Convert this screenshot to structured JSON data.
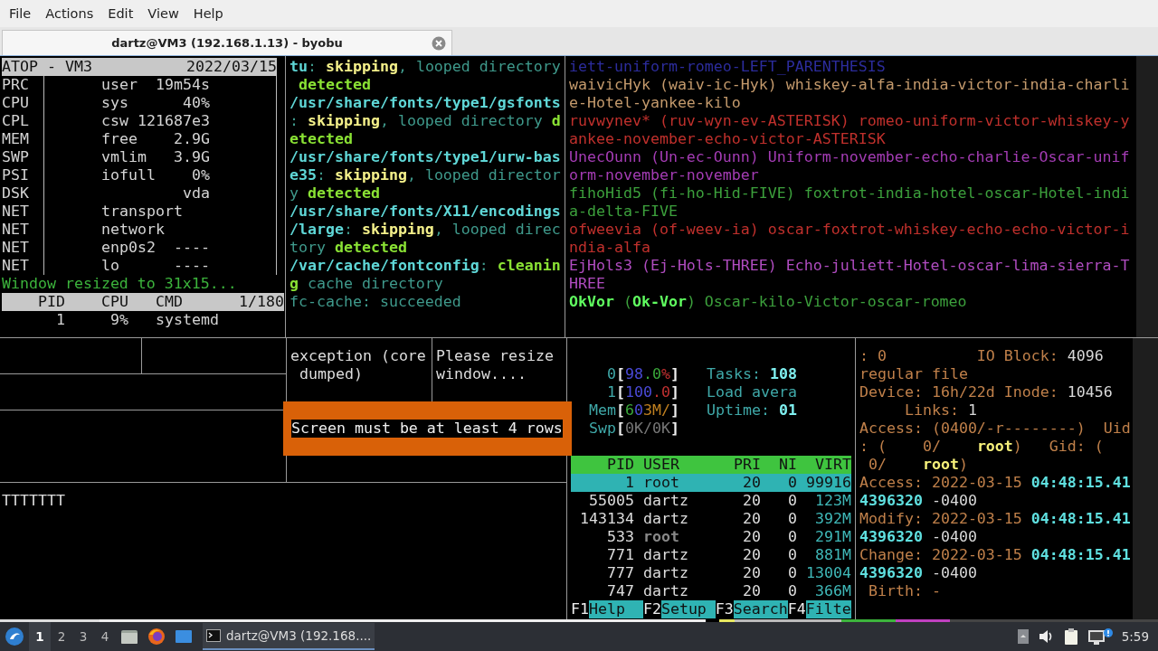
{
  "menu": [
    "File",
    "Actions",
    "Edit",
    "View",
    "Help"
  ],
  "tabs": [
    {
      "title": "dartz@VM3 (192.168.1.13) - byobu",
      "selected": true
    }
  ],
  "atop": {
    "title": "ATOP - VM3",
    "date": "2022/03/15",
    "rows": [
      {
        "label": "PRC",
        "key": "user",
        "value": "19m54s"
      },
      {
        "label": "CPU",
        "key": "sys",
        "value": "40%"
      },
      {
        "label": "CPL",
        "key": "csw",
        "value": "121687e3"
      },
      {
        "label": "MEM",
        "key": "free",
        "value": "2.9G"
      },
      {
        "label": "SWP",
        "key": "vmlim",
        "value": "3.9G"
      },
      {
        "label": "PSI",
        "key": "iofull",
        "value": "0%"
      },
      {
        "label": "DSK",
        "value": "vda"
      },
      {
        "label": "NET",
        "key": "transport"
      },
      {
        "label": "NET",
        "key": "network"
      },
      {
        "label": "NET",
        "key": "enp0s2",
        "value": "----"
      },
      {
        "label": "NET",
        "key": "lo",
        "value": "----"
      }
    ],
    "message": "Window resized to 31x15...",
    "proc_columns": [
      "PID",
      "CPU",
      "CMD"
    ],
    "proc_count": "1/180",
    "procs": [
      {
        "pid": "1",
        "cpu": "9%",
        "cmd": "systemd"
      }
    ]
  },
  "fc_cache_log": [
    [
      {
        "text": "tu",
        "kind": "path"
      },
      {
        "text": ": ",
        "kind": "dim"
      },
      {
        "text": "skipping",
        "kind": "warn"
      },
      {
        "text": ", looped directory",
        "kind": "dim"
      }
    ],
    [
      {
        "text": " detected",
        "kind": "ok"
      }
    ],
    [
      {
        "text": "/usr/share/fonts/type1/gsfonts",
        "kind": "path"
      }
    ],
    [
      {
        "text": ": ",
        "kind": "dim"
      },
      {
        "text": "skipping",
        "kind": "warn"
      },
      {
        "text": ", looped directory ",
        "kind": "dim"
      },
      {
        "text": "d",
        "kind": "ok"
      }
    ],
    [
      {
        "text": "etected",
        "kind": "ok"
      }
    ],
    [
      {
        "text": "/usr/share/fonts/type1/urw-bas",
        "kind": "path"
      }
    ],
    [
      {
        "text": "e35",
        "kind": "path"
      },
      {
        "text": ": ",
        "kind": "dim"
      },
      {
        "text": "skipping",
        "kind": "warn"
      },
      {
        "text": ", looped director",
        "kind": "dim"
      }
    ],
    [
      {
        "text": "y ",
        "kind": "dim"
      },
      {
        "text": "detected",
        "kind": "ok"
      }
    ],
    [
      {
        "text": "/usr/share/fonts/X11/encodings",
        "kind": "path"
      }
    ],
    [
      {
        "text": "/large",
        "kind": "path"
      },
      {
        "text": ": ",
        "kind": "dim"
      },
      {
        "text": "skipping",
        "kind": "warn"
      },
      {
        "text": ", looped direc",
        "kind": "dim"
      }
    ],
    [
      {
        "text": "tory ",
        "kind": "dim"
      },
      {
        "text": "detected",
        "kind": "ok"
      }
    ],
    [
      {
        "text": "/var/cache/fontconfig",
        "kind": "path"
      },
      {
        "text": ": ",
        "kind": "dim"
      },
      {
        "text": "cleanin",
        "kind": "ok"
      }
    ],
    [
      {
        "text": "g",
        "kind": "ok"
      },
      {
        "text": " cache directory",
        "kind": "dim"
      }
    ],
    [
      {
        "text": "fc-cache: succeeded",
        "kind": "dim"
      }
    ]
  ],
  "word_list": [
    {
      "text": "iett-uniform-romeo-LEFT_PARENTHESIS",
      "color": "#2c2c9c"
    },
    {
      "text": "waivicHyk (waiv-ic-Hyk) whiskey-alfa-india-victor-india-charlie-Hotel-yankee-kilo",
      "color": "#c49a6c"
    },
    {
      "text": "ruvwynev* (ruv-wyn-ev-ASTERISK) romeo-uniform-victor-whiskey-yankee-november-echo-victor-ASTERISK",
      "color": "#c0302c"
    },
    {
      "text": "UnecOunn (Un-ec-Ounn) Uniform-november-echo-charlie-Oscar-uniform-november-november",
      "color": "#a43cb4"
    },
    {
      "text": "fihoHid5 (fi-ho-Hid-FIVE) foxtrot-india-hotel-oscar-Hotel-india-delta-FIVE",
      "color": "#3ca03c"
    },
    {
      "text": "ofweevia (of-weev-ia) oscar-foxtrot-whiskey-echo-echo-victor-india-alfa",
      "color": "#c0302c"
    },
    {
      "text": "EjHols3 (Ej-Hols-THREE) Echo-juliett-Hotel-oscar-lima-sierra-THREE",
      "color": "#b04cc0"
    },
    {
      "text": "**OkVor** (**Ok-Vor**) Oscar-kilo-Victor-oscar-romeo",
      "color": "#3ca03c"
    }
  ],
  "exception_pane": [
    "exception (core",
    " dumped)"
  ],
  "resize_pane": [
    "Please resize",
    "window...."
  ],
  "alert": "Screen must be at least 4 rows",
  "left_bottom_text": "TTTTTTT",
  "htop": {
    "meters": [
      {
        "label": "0",
        "segments": [
          {
            "text": "[",
            "kind": "bracket"
          },
          {
            "text": "98",
            "kind": "low"
          },
          {
            "text": ".0",
            "kind": "normal"
          },
          {
            "text": "%",
            "kind": "kernel"
          },
          {
            "text": "]",
            "kind": "bracket"
          }
        ]
      },
      {
        "label": "1",
        "segments": [
          {
            "text": "[",
            "kind": "bracket"
          },
          {
            "text": "100",
            "kind": "low"
          },
          {
            "text": ".0",
            "kind": "kernel"
          },
          {
            "text": "]",
            "kind": "bracket"
          }
        ]
      },
      {
        "label": "Mem",
        "segments": [
          {
            "text": "[",
            "kind": "bracket"
          },
          {
            "text": "6",
            "kind": "normal"
          },
          {
            "text": "0",
            "kind": "low"
          },
          {
            "text": "3M/",
            "kind": "cache"
          },
          {
            "text": "]",
            "kind": "bracket"
          }
        ]
      },
      {
        "label": "Swp",
        "segments": [
          {
            "text": "[",
            "kind": "bracket"
          },
          {
            "text": "0K/0K",
            "kind": "empty"
          },
          {
            "text": "]",
            "kind": "bracket"
          }
        ]
      }
    ],
    "summary": [
      {
        "label": "Tasks: ",
        "value": "108"
      },
      {
        "label": "Load avera"
      },
      {
        "label": "Uptime: ",
        "value": "01"
      }
    ],
    "columns": [
      "PID",
      "USER",
      "PRI",
      "NI",
      "VIRT"
    ],
    "processes": [
      {
        "pid": "1",
        "user": "root",
        "pri": "20",
        "ni": "0",
        "virt": "99916",
        "selected": true,
        "dimmed": false
      },
      {
        "pid": "55005",
        "user": "dartz",
        "pri": "20",
        "ni": "0",
        "virt": "123M",
        "selected": false,
        "dimmed": false
      },
      {
        "pid": "143134",
        "user": "dartz",
        "pri": "20",
        "ni": "0",
        "virt": "392M",
        "selected": false,
        "dimmed": false
      },
      {
        "pid": "533",
        "user": "root",
        "pri": "20",
        "ni": "0",
        "virt": "291M",
        "selected": false,
        "dimmed": true
      },
      {
        "pid": "771",
        "user": "dartz",
        "pri": "20",
        "ni": "0",
        "virt": "881M",
        "selected": false,
        "dimmed": false
      },
      {
        "pid": "777",
        "user": "dartz",
        "pri": "20",
        "ni": "0",
        "virt": "13004",
        "selected": false,
        "dimmed": false
      },
      {
        "pid": "747",
        "user": "dartz",
        "pri": "20",
        "ni": "0",
        "virt": "366M",
        "selected": false,
        "dimmed": false
      }
    ],
    "function_keys": [
      {
        "key": "F1",
        "label": "Help"
      },
      {
        "key": "F2",
        "label": "Setup"
      },
      {
        "key": "F3",
        "label": "Search"
      },
      {
        "key": "F4",
        "label": "Filte"
      }
    ]
  },
  "stat": [
    [
      {
        "text": ": 0          IO Block: ",
        "kind": "label"
      },
      {
        "text": "4096",
        "kind": "value"
      }
    ],
    [
      {
        "text": "regular file",
        "kind": "label"
      }
    ],
    [
      {
        "text": "Device: 16h/22d Inode: ",
        "kind": "label"
      },
      {
        "text": "10456",
        "kind": "value"
      }
    ],
    [
      {
        "text": "     Links: ",
        "kind": "label"
      },
      {
        "text": "1",
        "kind": "value"
      }
    ],
    [
      {
        "text": "Access: (0400/-r--------)  Uid",
        "kind": "label"
      }
    ],
    [
      {
        "text": ": (    0/    ",
        "kind": "label"
      },
      {
        "text": "root",
        "kind": "user"
      },
      {
        "text": ")   Gid: (",
        "kind": "label"
      }
    ],
    [
      {
        "text": " 0/    ",
        "kind": "label"
      },
      {
        "text": "root",
        "kind": "user"
      },
      {
        "text": ")",
        "kind": "label"
      }
    ],
    [
      {
        "text": "Access: 2022-03-15 ",
        "kind": "label"
      },
      {
        "text": "04:48:15.41",
        "kind": "time"
      }
    ],
    [
      {
        "text": "4396320",
        "kind": "time"
      },
      {
        "text": " -0400",
        "kind": "value"
      }
    ],
    [
      {
        "text": "Modify: 2022-03-15 ",
        "kind": "label"
      },
      {
        "text": "04:48:15.41",
        "kind": "time"
      }
    ],
    [
      {
        "text": "4396320",
        "kind": "time"
      },
      {
        "text": " -0400",
        "kind": "value"
      }
    ],
    [
      {
        "text": "Change: 2022-03-15 ",
        "kind": "label"
      },
      {
        "text": "04:48:15.41",
        "kind": "time"
      }
    ],
    [
      {
        "text": "4396320",
        "kind": "time"
      },
      {
        "text": " -0400",
        "kind": "value"
      }
    ],
    [
      {
        "text": " Birth: -",
        "kind": "label"
      }
    ]
  ],
  "taskbar": {
    "workspaces": [
      {
        "label": "1",
        "selected": true
      },
      {
        "label": "2",
        "selected": false
      },
      {
        "label": "3",
        "selected": false
      },
      {
        "label": "4",
        "selected": false
      }
    ],
    "task": "dartz@VM3 (192.168....",
    "clock": "5:59"
  }
}
